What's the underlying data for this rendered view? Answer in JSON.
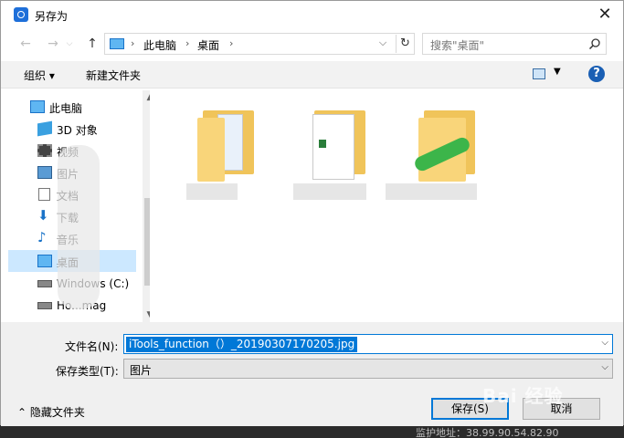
{
  "window": {
    "title": "另存为",
    "close_glyph": "✕"
  },
  "nav": {
    "back": "←",
    "forward": "→",
    "up": "↑"
  },
  "address": {
    "crumbs": [
      "此电脑",
      "桌面"
    ],
    "sep": "›",
    "dropdown": "⌵",
    "refresh": "↻"
  },
  "search": {
    "placeholder": "搜索\"桌面\""
  },
  "toolbar": {
    "organize": "组织 ▾",
    "new_folder": "新建文件夹",
    "view_dd": "▼",
    "help": "?"
  },
  "navpane": {
    "items": [
      {
        "label": "此电脑",
        "icon": "computer-icon"
      },
      {
        "label": "3D 对象",
        "icon": "3d-objects-icon"
      },
      {
        "label": "视频",
        "icon": "video-icon"
      },
      {
        "label": "图片",
        "icon": "pictures-icon"
      },
      {
        "label": "文档",
        "icon": "documents-icon"
      },
      {
        "label": "下载",
        "icon": "download-icon"
      },
      {
        "label": "音乐",
        "icon": "music-icon"
      },
      {
        "label": "桌面",
        "icon": "desktop-icon"
      },
      {
        "label": "Windows (C:)",
        "icon": "drive-icon"
      },
      {
        "label": "Ho...mag",
        "icon": "drive-icon"
      }
    ],
    "scroll_up": "▲",
    "scroll_down": "▼"
  },
  "form": {
    "filename_label": "文件名(N):",
    "filename_value": "iTools_function（）_20190307170205.jpg",
    "filetype_label": "保存类型(T):",
    "filetype_value": "图片",
    "dd": "⌵"
  },
  "footer": {
    "hide_folders": "⌃  隐藏文件夹",
    "save": "保存(S)",
    "cancel": "取消"
  },
  "watermark": "Bai 经验",
  "behind": "监护地址：38.99.90.54.82.90",
  "colors": {
    "accent": "#0078d7",
    "folder": "#f9d57a",
    "selected": "#cce8ff"
  }
}
